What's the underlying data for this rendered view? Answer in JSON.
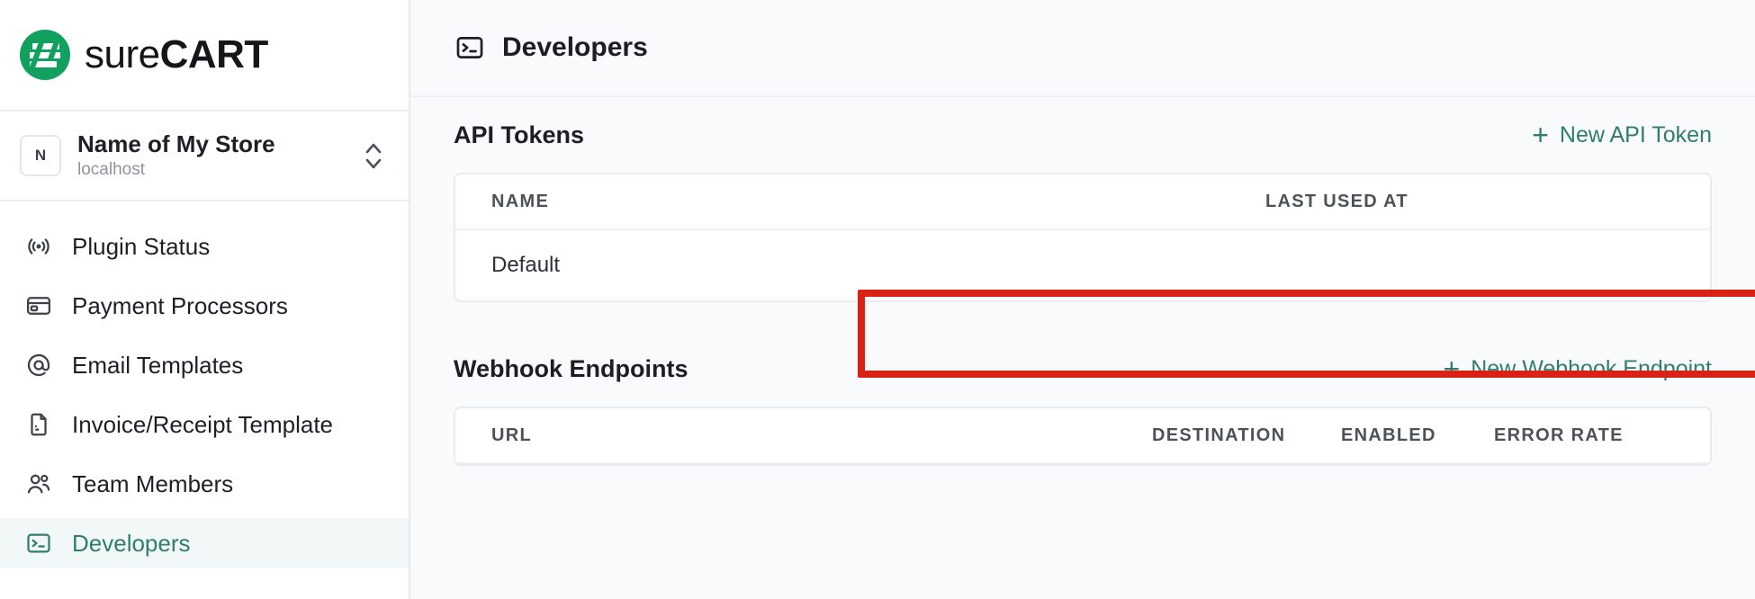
{
  "brand": {
    "name_light": "sure",
    "name_bold": "CART",
    "logo_icon": "surecart-logo-icon",
    "logo_color": "#12a05e"
  },
  "store_selector": {
    "avatar_initial": "N",
    "name": "Name of My Store",
    "host": "localhost",
    "chevron_icon": "chevron-up-down-icon"
  },
  "sidebar": {
    "items": [
      {
        "label": "Plugin Status",
        "icon": "broadcast-icon",
        "active": false
      },
      {
        "label": "Payment Processors",
        "icon": "credit-card-icon",
        "active": false
      },
      {
        "label": "Email Templates",
        "icon": "at-sign-icon",
        "active": false
      },
      {
        "label": "Invoice/Receipt Template",
        "icon": "document-icon",
        "active": false
      },
      {
        "label": "Team Members",
        "icon": "users-icon",
        "active": false
      },
      {
        "label": "Developers",
        "icon": "terminal-icon",
        "active": true
      }
    ]
  },
  "page_header": {
    "title": "Developers",
    "icon": "terminal-icon"
  },
  "api_tokens": {
    "title": "API Tokens",
    "action_label": "New API Token",
    "action_icon": "plus-icon",
    "columns": [
      "NAME",
      "LAST USED AT"
    ],
    "rows": [
      {
        "name": "Default",
        "last_used_at": ""
      }
    ]
  },
  "webhook_endpoints": {
    "title": "Webhook Endpoints",
    "action_label": "New Webhook Endpoint",
    "action_icon": "plus-icon",
    "columns": [
      "URL",
      "DESTINATION",
      "ENABLED",
      "ERROR RATE"
    ]
  },
  "annotation": {
    "color": "#d92115",
    "target": "api-token-row-default"
  },
  "cursor": {
    "type": "pointing-hand-cursor"
  },
  "colors": {
    "accent_green": "#2f7d6e",
    "logo_green": "#12a05e",
    "annotation_red": "#d92115",
    "canvas": "#f9fafb"
  }
}
